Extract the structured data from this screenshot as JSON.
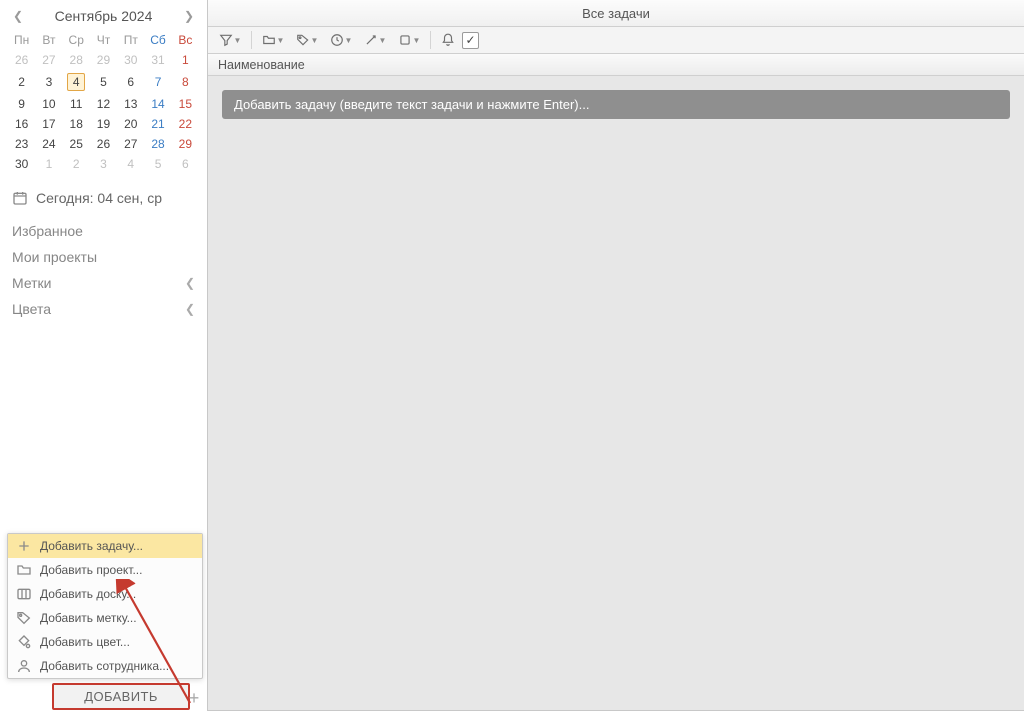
{
  "calendar": {
    "title": "Сентябрь 2024",
    "dow": [
      "Пн",
      "Вт",
      "Ср",
      "Чт",
      "Пт",
      "Сб",
      "Вс"
    ],
    "weeks": [
      {
        "cells": [
          {
            "d": "26",
            "cls": "muted"
          },
          {
            "d": "27",
            "cls": "muted"
          },
          {
            "d": "28",
            "cls": "muted"
          },
          {
            "d": "29",
            "cls": "muted"
          },
          {
            "d": "30",
            "cls": "muted"
          },
          {
            "d": "31",
            "cls": "muted"
          },
          {
            "d": "1",
            "cls": "sun"
          }
        ]
      },
      {
        "cells": [
          {
            "d": "2",
            "cls": ""
          },
          {
            "d": "3",
            "cls": ""
          },
          {
            "d": "4",
            "cls": "sel"
          },
          {
            "d": "5",
            "cls": ""
          },
          {
            "d": "6",
            "cls": ""
          },
          {
            "d": "7",
            "cls": "sat"
          },
          {
            "d": "8",
            "cls": "sun"
          }
        ]
      },
      {
        "cells": [
          {
            "d": "9",
            "cls": ""
          },
          {
            "d": "10",
            "cls": ""
          },
          {
            "d": "11",
            "cls": ""
          },
          {
            "d": "12",
            "cls": ""
          },
          {
            "d": "13",
            "cls": ""
          },
          {
            "d": "14",
            "cls": "sat"
          },
          {
            "d": "15",
            "cls": "sun"
          }
        ]
      },
      {
        "cells": [
          {
            "d": "16",
            "cls": ""
          },
          {
            "d": "17",
            "cls": ""
          },
          {
            "d": "18",
            "cls": ""
          },
          {
            "d": "19",
            "cls": ""
          },
          {
            "d": "20",
            "cls": ""
          },
          {
            "d": "21",
            "cls": "sat"
          },
          {
            "d": "22",
            "cls": "sun"
          }
        ]
      },
      {
        "cells": [
          {
            "d": "23",
            "cls": ""
          },
          {
            "d": "24",
            "cls": ""
          },
          {
            "d": "25",
            "cls": ""
          },
          {
            "d": "26",
            "cls": ""
          },
          {
            "d": "27",
            "cls": ""
          },
          {
            "d": "28",
            "cls": "sat"
          },
          {
            "d": "29",
            "cls": "sun"
          }
        ]
      },
      {
        "cells": [
          {
            "d": "30",
            "cls": ""
          },
          {
            "d": "1",
            "cls": "muted"
          },
          {
            "d": "2",
            "cls": "muted"
          },
          {
            "d": "3",
            "cls": "muted"
          },
          {
            "d": "4",
            "cls": "muted"
          },
          {
            "d": "5",
            "cls": "muted"
          },
          {
            "d": "6",
            "cls": "muted"
          }
        ]
      }
    ]
  },
  "today": {
    "label": "Сегодня: 04 сен, ср"
  },
  "nav": {
    "favorites": "Избранное",
    "projects": "Мои проекты",
    "tags": "Метки",
    "colors": "Цвета"
  },
  "context_menu": {
    "items": [
      {
        "label": "Добавить задачу...",
        "icon": "plus-icon",
        "hover": true
      },
      {
        "label": "Добавить проект...",
        "icon": "folder-icon",
        "hover": false
      },
      {
        "label": "Добавить доску...",
        "icon": "board-icon",
        "hover": false
      },
      {
        "label": "Добавить метку...",
        "icon": "tag-icon",
        "hover": false
      },
      {
        "label": "Добавить цвет...",
        "icon": "color-icon",
        "hover": false
      },
      {
        "label": "Добавить сотрудника...",
        "icon": "user-icon",
        "hover": false
      }
    ]
  },
  "add_button": {
    "label": "ДОБАВИТЬ"
  },
  "main": {
    "title": "Все задачи",
    "column_header": "Наименование",
    "task_placeholder": "Добавить задачу (введите текст задачи и нажмите Enter)..."
  }
}
